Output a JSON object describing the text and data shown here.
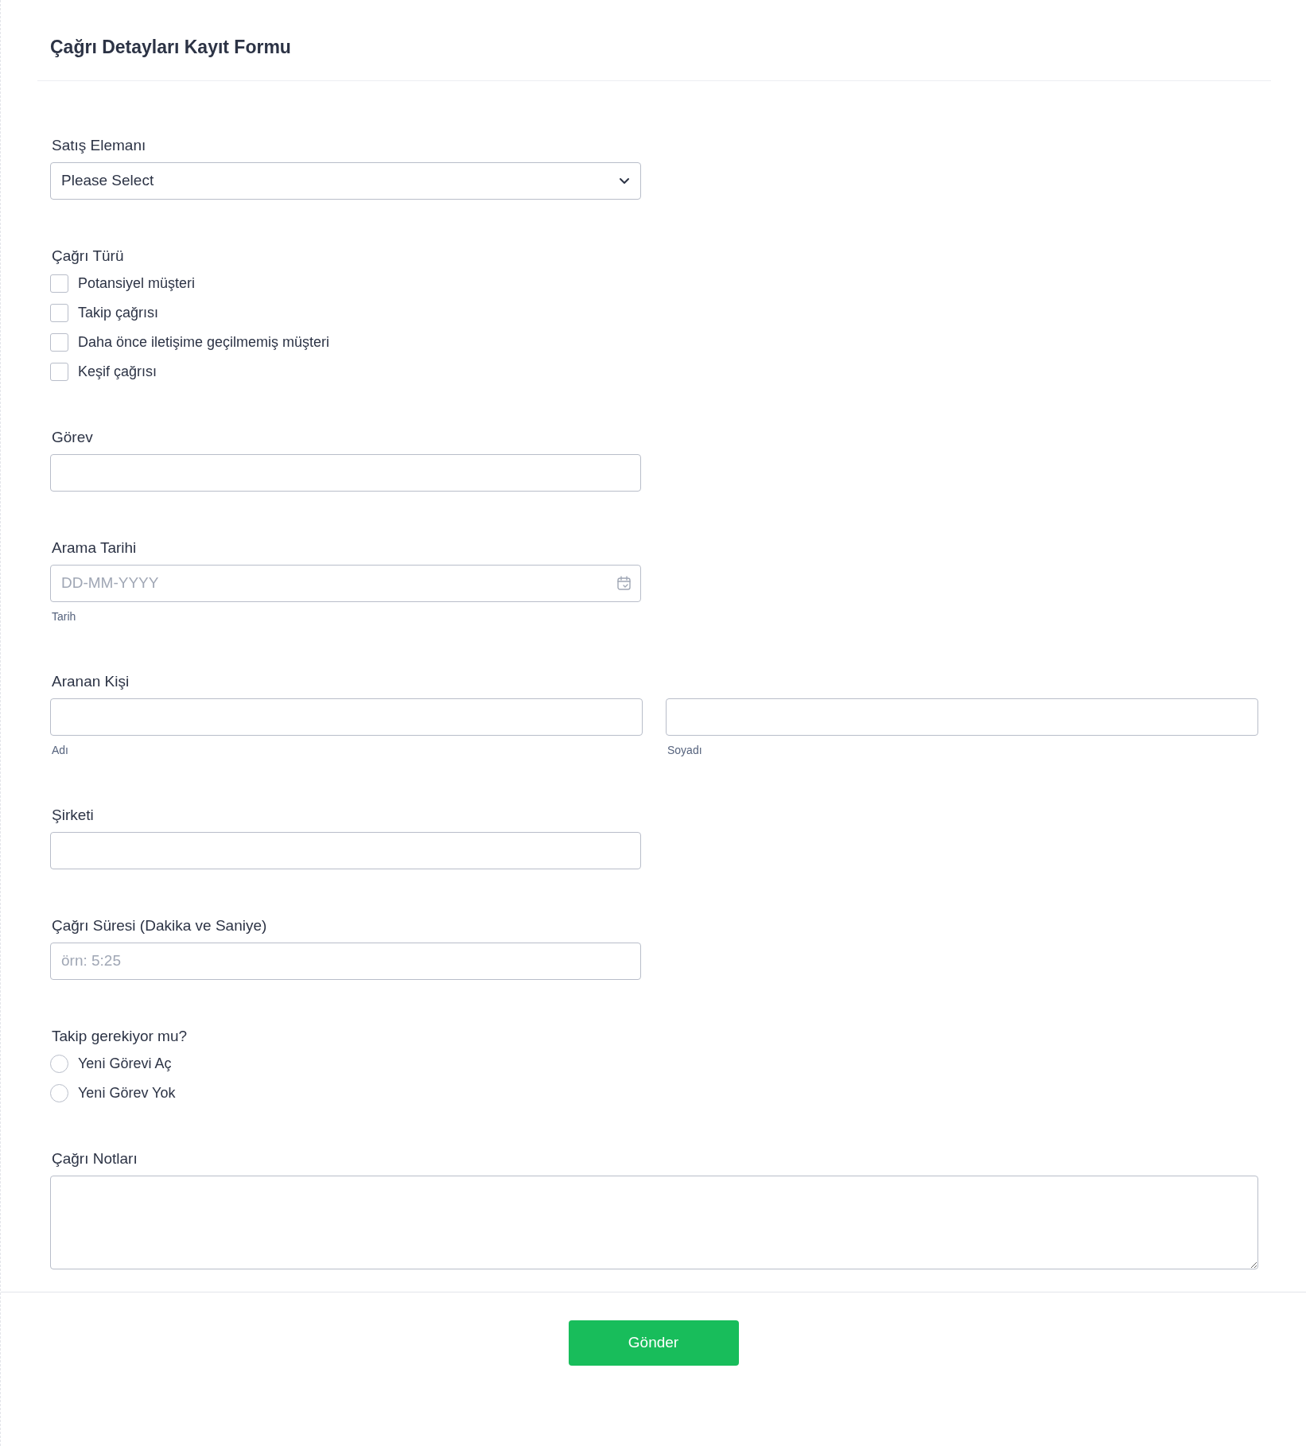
{
  "title": "Çağrı Detayları Kayıt Formu",
  "fields": [
    {
      "kind": "select",
      "label": "Satış Elemanı",
      "value": "Please Select"
    },
    {
      "kind": "checkboxes",
      "label": "Çağrı Türü",
      "options": [
        {
          "label": "Potansiyel müşteri",
          "checked": false
        },
        {
          "label": "Takip çağrısı",
          "checked": false
        },
        {
          "label": "Daha önce iletişime geçilmemiş müşteri",
          "checked": false
        },
        {
          "label": "Keşif çağrısı",
          "checked": false
        }
      ]
    },
    {
      "kind": "text",
      "label": "Görev"
    },
    {
      "kind": "date",
      "label": "Arama Tarihi",
      "placeholder": "DD-MM-YYYY",
      "sublabel": "Tarih"
    },
    {
      "kind": "name",
      "label": "Aranan Kişi",
      "sublabels": [
        "Adı",
        "Soyadı"
      ]
    },
    {
      "kind": "text",
      "label": "Şirketi"
    },
    {
      "kind": "text",
      "label": "Çağrı Süresi (Dakika ve Saniye)",
      "placeholder": "örn: 5:25"
    },
    {
      "kind": "radios",
      "label": "Takip gerekiyor mu?",
      "options": [
        {
          "label": "Yeni Görevi Aç",
          "selected": false
        },
        {
          "label": "Yeni Görev Yok",
          "selected": false
        }
      ]
    },
    {
      "kind": "textarea",
      "label": "Çağrı Notları"
    }
  ],
  "submit": "Gönder"
}
